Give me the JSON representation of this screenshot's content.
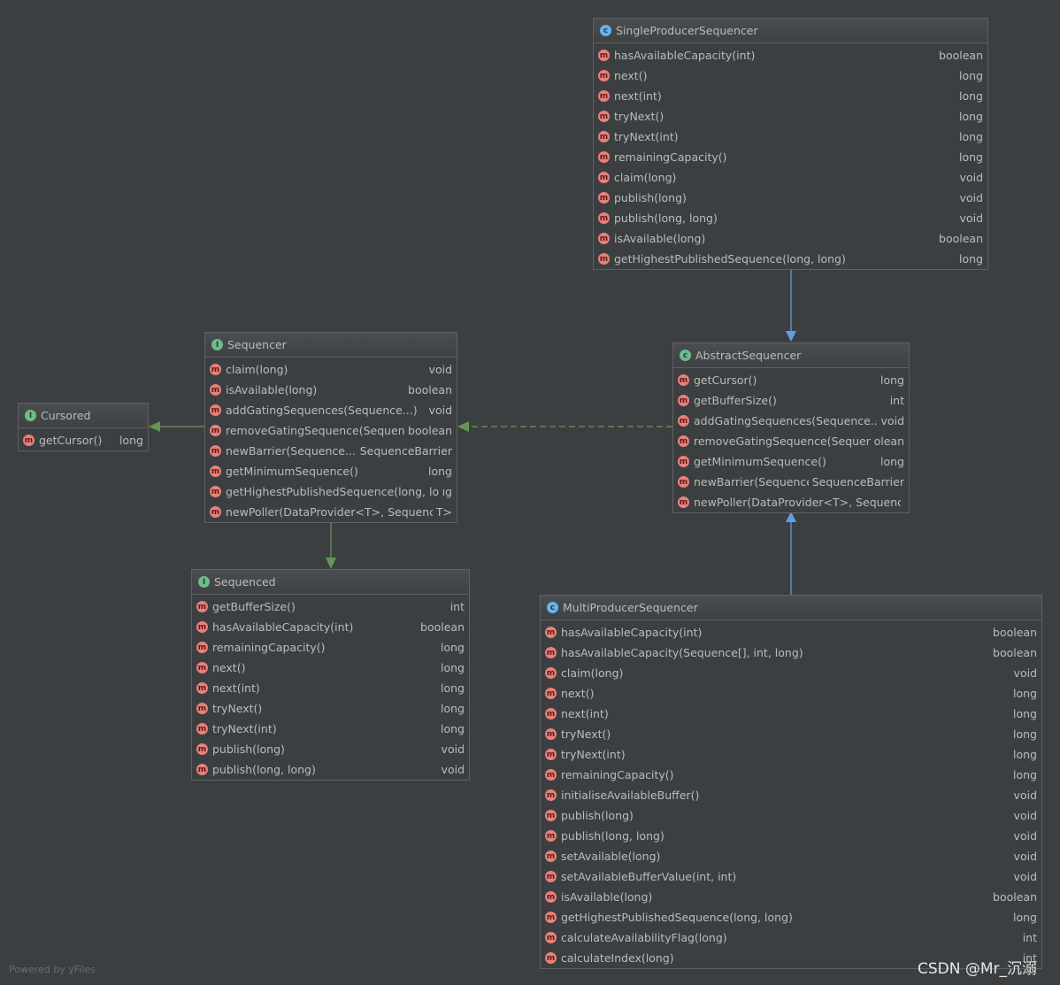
{
  "nodes": {
    "single": {
      "title": "SingleProducerSequencer",
      "kind": "class",
      "kind_letter": "c",
      "members": [
        {
          "name": "hasAvailableCapacity(int)",
          "type": "boolean"
        },
        {
          "name": "next()",
          "type": "long"
        },
        {
          "name": "next(int)",
          "type": "long"
        },
        {
          "name": "tryNext()",
          "type": "long"
        },
        {
          "name": "tryNext(int)",
          "type": "long"
        },
        {
          "name": "remainingCapacity()",
          "type": "long"
        },
        {
          "name": "claim(long)",
          "type": "void"
        },
        {
          "name": "publish(long)",
          "type": "void"
        },
        {
          "name": "publish(long, long)",
          "type": "void"
        },
        {
          "name": "isAvailable(long)",
          "type": "boolean"
        },
        {
          "name": "getHighestPublishedSequence(long, long)",
          "type": "long"
        }
      ]
    },
    "sequencer": {
      "title": "Sequencer",
      "kind": "interface",
      "kind_letter": "I",
      "members": [
        {
          "name": "claim(long)",
          "type": "void"
        },
        {
          "name": "isAvailable(long)",
          "type": "boolean"
        },
        {
          "name": "addGatingSequences(Sequence...)",
          "type": "void"
        },
        {
          "name": "removeGatingSequence(Sequence)",
          "type": "boolean"
        },
        {
          "name": "newBarrier(Sequence...)",
          "type": "SequenceBarrier"
        },
        {
          "name": "getMinimumSequence()",
          "type": "long"
        },
        {
          "name": "getHighestPublishedSequence(long, long)",
          "type": "ıg"
        },
        {
          "name": "newPoller(DataProvider<T>, Sequence...)",
          "type": "T>"
        }
      ]
    },
    "cursored": {
      "title": "Cursored",
      "kind": "interface",
      "kind_letter": "I",
      "members": [
        {
          "name": "getCursor()",
          "type": "long"
        }
      ]
    },
    "abstract": {
      "title": "AbstractSequencer",
      "kind": "abstract",
      "kind_letter": "c",
      "members": [
        {
          "name": "getCursor()",
          "type": "long"
        },
        {
          "name": "getBufferSize()",
          "type": "int"
        },
        {
          "name": "addGatingSequences(Sequence...)",
          "type": "void"
        },
        {
          "name": "removeGatingSequence(Sequence)",
          "type": "olean"
        },
        {
          "name": "getMinimumSequence()",
          "type": "long"
        },
        {
          "name": "newBarrier(Sequence...)",
          "type": "SequenceBarrier"
        },
        {
          "name": "newPoller(DataProvider<T>, Sequence...)",
          "type": ""
        }
      ]
    },
    "sequenced": {
      "title": "Sequenced",
      "kind": "interface",
      "kind_letter": "I",
      "members": [
        {
          "name": "getBufferSize()",
          "type": "int"
        },
        {
          "name": "hasAvailableCapacity(int)",
          "type": "boolean"
        },
        {
          "name": "remainingCapacity()",
          "type": "long"
        },
        {
          "name": "next()",
          "type": "long"
        },
        {
          "name": "next(int)",
          "type": "long"
        },
        {
          "name": "tryNext()",
          "type": "long"
        },
        {
          "name": "tryNext(int)",
          "type": "long"
        },
        {
          "name": "publish(long)",
          "type": "void"
        },
        {
          "name": "publish(long, long)",
          "type": "void"
        }
      ]
    },
    "multi": {
      "title": "MultiProducerSequencer",
      "kind": "class",
      "kind_letter": "c",
      "members": [
        {
          "name": "hasAvailableCapacity(int)",
          "type": "boolean"
        },
        {
          "name": "hasAvailableCapacity(Sequence[], int, long)",
          "type": "boolean"
        },
        {
          "name": "claim(long)",
          "type": "void"
        },
        {
          "name": "next()",
          "type": "long"
        },
        {
          "name": "next(int)",
          "type": "long"
        },
        {
          "name": "tryNext()",
          "type": "long"
        },
        {
          "name": "tryNext(int)",
          "type": "long"
        },
        {
          "name": "remainingCapacity()",
          "type": "long"
        },
        {
          "name": "initialiseAvailableBuffer()",
          "type": "void"
        },
        {
          "name": "publish(long)",
          "type": "void"
        },
        {
          "name": "publish(long, long)",
          "type": "void"
        },
        {
          "name": "setAvailable(long)",
          "type": "void"
        },
        {
          "name": "setAvailableBufferValue(int, int)",
          "type": "void"
        },
        {
          "name": "isAvailable(long)",
          "type": "boolean"
        },
        {
          "name": "getHighestPublishedSequence(long, long)",
          "type": "long"
        },
        {
          "name": "calculateAvailabilityFlag(long)",
          "type": "int"
        },
        {
          "name": "calculateIndex(long)",
          "type": "int"
        }
      ]
    }
  },
  "member_icon_letter": "m",
  "colors": {
    "extends_edge": "#5e9ee8",
    "implements_edge": "#629755",
    "background": "#3c3f41"
  },
  "footer": "Powered by yFiles",
  "watermark": "CSDN @Mr_沉溺"
}
